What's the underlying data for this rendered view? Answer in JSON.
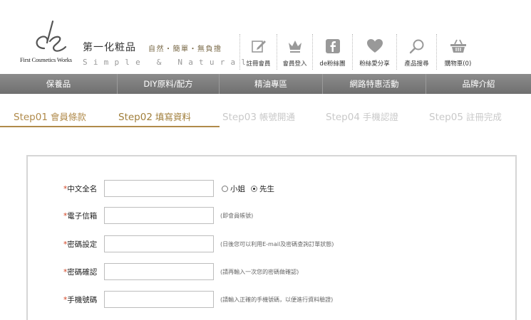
{
  "brand": {
    "logo_text": "First Cosmetics Works",
    "name_cn": "第一化粧品",
    "tagline": "自然・簡單・無負擔",
    "slogan_en": "Simple & Natural"
  },
  "toolbar": [
    {
      "label": "註冊會員",
      "icon": "pencil-icon"
    },
    {
      "label": "會員登入",
      "icon": "crown-icon"
    },
    {
      "label": "de粉絲團",
      "icon": "facebook-icon"
    },
    {
      "label": "粉絲愛分享",
      "icon": "heart-icon"
    },
    {
      "label": "產品搜尋",
      "icon": "search-icon"
    },
    {
      "label": "購物車(0)",
      "icon": "basket-icon"
    }
  ],
  "nav": [
    "保養品",
    "DIY原料/配方",
    "精油專區",
    "網路特惠活動",
    "品牌介紹"
  ],
  "steps": [
    {
      "num": "Step01",
      "label": "會員條款",
      "state": "done"
    },
    {
      "num": "Step02",
      "label": "填寫資料",
      "state": "active"
    },
    {
      "num": "Step03",
      "label": "帳號開通",
      "state": "todo"
    },
    {
      "num": "Step04",
      "label": "手機認證",
      "state": "todo"
    },
    {
      "num": "Step05",
      "label": "註冊完成",
      "state": "todo"
    }
  ],
  "form": {
    "required_mark": "*",
    "name": {
      "label": "中文全名",
      "value": ""
    },
    "gender": {
      "options": [
        "小姐",
        "先生"
      ],
      "selected": "先生"
    },
    "email": {
      "label": "電子信箱",
      "value": "",
      "hint": "(即會員帳號)"
    },
    "password": {
      "label": "密碼設定",
      "value": "",
      "hint": "(日後您可以利用E-mail及密碼查詢訂單狀態)"
    },
    "password_confirm": {
      "label": "密碼確認",
      "value": "",
      "hint": "(請再輸入一次您的密碼做確認)"
    },
    "mobile": {
      "label": "手機號碼",
      "value": "",
      "hint": "(請輸入正確的手機號碼，以便進行資料驗證)"
    }
  },
  "colors": {
    "accent_gold": "#b08a4a",
    "nav_gray": "#7d7d7d",
    "required_red": "#d04020"
  }
}
